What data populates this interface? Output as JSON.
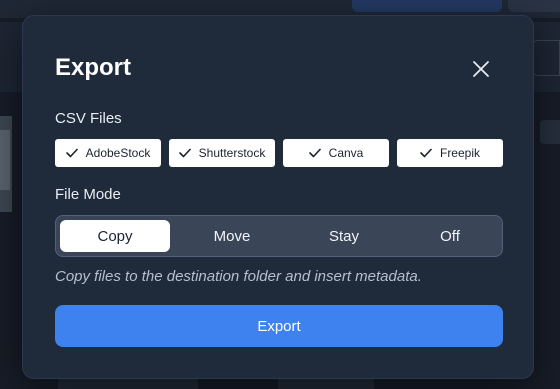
{
  "dialog": {
    "title": "Export",
    "close_icon": "close-icon"
  },
  "csv_files": {
    "label": "CSV Files",
    "check_icon": "check-icon",
    "options": [
      {
        "label": "AdobeStock",
        "checked": true
      },
      {
        "label": "Shutterstock",
        "checked": true
      },
      {
        "label": "Canva",
        "checked": true
      },
      {
        "label": "Freepik",
        "checked": true
      }
    ]
  },
  "file_mode": {
    "label": "File Mode",
    "selected": "Copy",
    "options": [
      "Copy",
      "Move",
      "Stay",
      "Off"
    ],
    "description": "Copy files to the destination folder and insert metadata."
  },
  "export_button": {
    "label": "Export",
    "color": "#3d82ee"
  }
}
